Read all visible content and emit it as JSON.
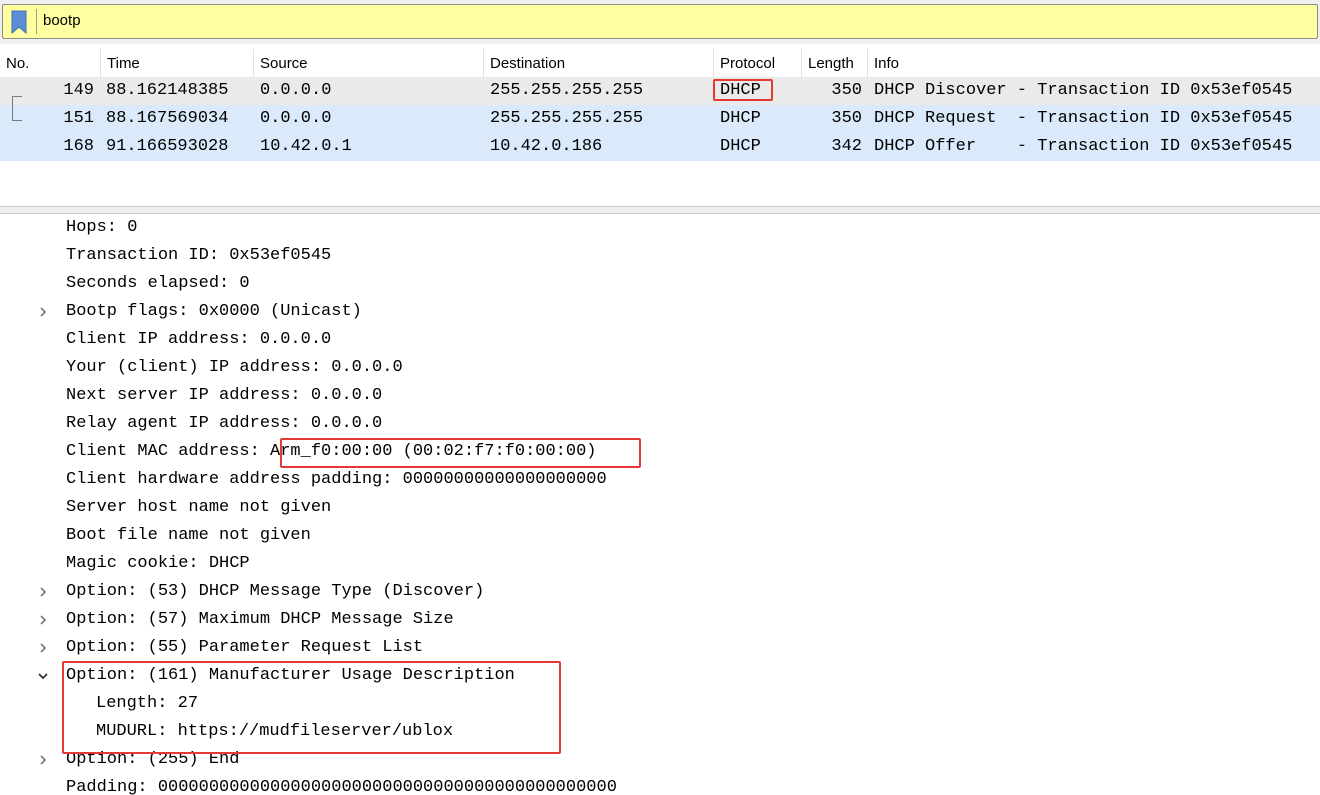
{
  "filter": {
    "value": "bootp",
    "icon": "bookmark-icon",
    "accent": "#5b8ed6",
    "bg": "#ffffa0"
  },
  "columns": [
    "No.",
    "Time",
    "Source",
    "Destination",
    "Protocol",
    "Length",
    "Info"
  ],
  "packets": [
    {
      "no": "149",
      "time": "88.162148385",
      "source": "0.0.0.0",
      "destination": "255.255.255.255",
      "protocol": "DHCP",
      "length": "350",
      "info": "DHCP Discover - Transaction ID 0x53ef0545"
    },
    {
      "no": "151",
      "time": "88.167569034",
      "source": "0.0.0.0",
      "destination": "255.255.255.255",
      "protocol": "DHCP",
      "length": "350",
      "info": "DHCP Request  - Transaction ID 0x53ef0545"
    },
    {
      "no": "168",
      "time": "91.166593028",
      "source": "10.42.0.1",
      "destination": "10.42.0.186",
      "protocol": "DHCP",
      "length": "342",
      "info": "DHCP Offer    - Transaction ID 0x53ef0545"
    }
  ],
  "details": [
    {
      "text": "Hops: 0",
      "toggle": "none"
    },
    {
      "text": "Transaction ID: 0x53ef0545",
      "toggle": "none"
    },
    {
      "text": "Seconds elapsed: 0",
      "toggle": "none"
    },
    {
      "text": "Bootp flags: 0x0000 (Unicast)",
      "toggle": "collapsed"
    },
    {
      "text": "Client IP address: 0.0.0.0",
      "toggle": "none"
    },
    {
      "text": "Your (client) IP address: 0.0.0.0",
      "toggle": "none"
    },
    {
      "text": "Next server IP address: 0.0.0.0",
      "toggle": "none"
    },
    {
      "text": "Relay agent IP address: 0.0.0.0",
      "toggle": "none"
    },
    {
      "text": "Client MAC address: Arm_f0:00:00 (00:02:f7:f0:00:00)",
      "toggle": "none"
    },
    {
      "text": "Client hardware address padding: 00000000000000000000",
      "toggle": "none"
    },
    {
      "text": "Server host name not given",
      "toggle": "none"
    },
    {
      "text": "Boot file name not given",
      "toggle": "none"
    },
    {
      "text": "Magic cookie: DHCP",
      "toggle": "none"
    },
    {
      "text": "Option: (53) DHCP Message Type (Discover)",
      "toggle": "collapsed"
    },
    {
      "text": "Option: (57) Maximum DHCP Message Size",
      "toggle": "collapsed"
    },
    {
      "text": "Option: (55) Parameter Request List",
      "toggle": "collapsed"
    },
    {
      "text": "Option: (161) Manufacturer Usage Description",
      "toggle": "expanded"
    },
    {
      "text": "Length: 27",
      "toggle": "child"
    },
    {
      "text": "MUDURL: https://mudfileserver/ublox",
      "toggle": "child"
    },
    {
      "text": "Option: (255) End",
      "toggle": "collapsed"
    },
    {
      "text": "Padding: 000000000000000000000000000000000000000000000",
      "toggle": "none"
    }
  ],
  "colors": {
    "selected_row": "#eaeaea",
    "related_row": "#daeafa",
    "highlight": "#e53935"
  }
}
